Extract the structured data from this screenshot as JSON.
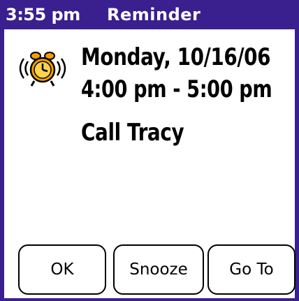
{
  "header": {
    "time": "3:55 pm",
    "title": "Reminder"
  },
  "reminder": {
    "icon": "alarm-clock-ringing-icon",
    "date": "Monday, 10/16/06",
    "time_range": "4:00 pm - 5:00 pm",
    "description": "Call Tracy"
  },
  "buttons": {
    "ok_label": "OK",
    "snooze_label": "Snooze",
    "goto_label": "Go To"
  },
  "colors": {
    "title_bar": "#3a1f8f",
    "alarm_bell": "#f0a000"
  }
}
